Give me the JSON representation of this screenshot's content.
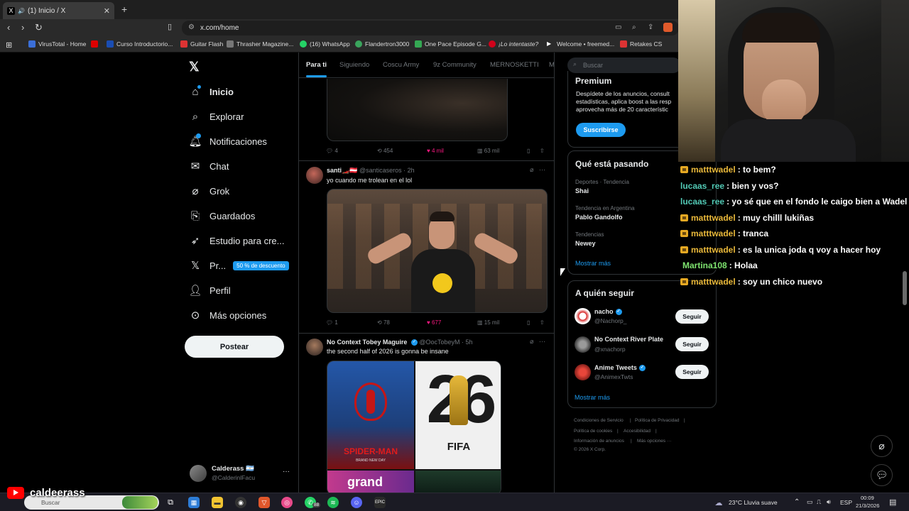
{
  "browser": {
    "tab_title": "(1) Inicio / X",
    "tab_favicon": "X",
    "url": "x.com/home",
    "bookmarks": [
      {
        "label": "VirusTotal - Home",
        "color": "#3b6fd8"
      },
      {
        "label": "Curso Introductorio...",
        "color": "#1a4db3"
      },
      {
        "label": "Guitar Flash",
        "color": "#d33"
      },
      {
        "label": "Thrasher Magazine...",
        "color": "#555"
      },
      {
        "label": "(16) WhatsApp",
        "color": "#25d366"
      },
      {
        "label": "Flandertron3000",
        "color": "#3aa55d"
      },
      {
        "label": "One Pace Episode G...",
        "color": "#34a853"
      },
      {
        "label": "¡Lo intentaste?",
        "color": "#d0021b"
      },
      {
        "label": "Welcome • freemed...",
        "color": "#fff"
      },
      {
        "label": "Retakes CS",
        "color": "#d33"
      }
    ]
  },
  "nav": {
    "items": [
      {
        "label": "Inicio",
        "icon": "home-icon"
      },
      {
        "label": "Explorar",
        "icon": "search-icon"
      },
      {
        "label": "Notificaciones",
        "icon": "bell-icon"
      },
      {
        "label": "Chat",
        "icon": "mail-icon"
      },
      {
        "label": "Grok",
        "icon": "grok-icon"
      },
      {
        "label": "Guardados",
        "icon": "bookmark-icon"
      },
      {
        "label": "Estudio para cre...",
        "icon": "rocket-icon"
      },
      {
        "label": "Pr...",
        "icon": "x-logo-icon",
        "badge": "50 % de descuento"
      },
      {
        "label": "Perfil",
        "icon": "user-icon"
      },
      {
        "label": "Más opciones",
        "icon": "more-circle-icon"
      }
    ],
    "post_button": "Postear",
    "account": {
      "name": "Calderass 🇦🇷",
      "handle": "@CalderinlFacu",
      "more": "···"
    }
  },
  "timeline": {
    "tabs": [
      "Para ti",
      "Siguiendo",
      "Coscu Army",
      "9z Community",
      "MERNOSKETTI",
      "M"
    ],
    "first_actions": {
      "replies": "4",
      "reposts": "454",
      "likes": "4 mil",
      "views": "63 mil"
    },
    "posts": [
      {
        "name": "santi🏎️🇦🇹",
        "handle": "@santicaseros · 2h",
        "text": "yo cuando me trolean en el lol",
        "actions": {
          "replies": "1",
          "reposts": "78",
          "likes": "677",
          "views": "15 mil"
        }
      },
      {
        "name": "No Context Tobey Maguire",
        "handle": "@OocTobeyM · 5h",
        "text": "the second half of 2026 is gonna be insane",
        "media_labels": {
          "spider": "SPIDER-MAN",
          "spider_sub": "BRAND NEW DAY",
          "fifa": "FIFA",
          "fifa_digits": "26",
          "gta": "grand"
        }
      }
    ]
  },
  "sidebar": {
    "search_placeholder": "Buscar",
    "premium": {
      "title": "Premium",
      "body_1": "Despídete de los anuncios, consult",
      "body_2": "estadísticas, aplica boost a las resp",
      "body_3": "aprovecha más de 20 característic",
      "button": "Suscribirse"
    },
    "trends": {
      "title": "Qué está pasando",
      "items": [
        {
          "context": "Deportes · Tendencia",
          "name": "Shai"
        },
        {
          "context": "Tendencia en Argentina",
          "name": "Pablo Gandolfo"
        },
        {
          "context": "Tendencias",
          "name": "Newey"
        }
      ],
      "more": "Mostrar más"
    },
    "who_to_follow": {
      "title": "A quién seguir",
      "items": [
        {
          "name": "nacho",
          "handle": "@Nachorp_",
          "verified": true,
          "button": "Seguir"
        },
        {
          "name": "No Context River Plate",
          "handle": "@xnachorp",
          "verified": false,
          "button": "Seguir"
        },
        {
          "name": "Anime Tweets",
          "handle": "@AnimexTwts",
          "verified": true,
          "button": "Seguir"
        }
      ],
      "more": "Mostrar más"
    },
    "footer": {
      "terms": "Condiciones de Servicio",
      "privacy": "Política de Privacidad",
      "cookies": "Política de cookies",
      "accessibility": "Accesibilidad",
      "ads": "Información de anuncios",
      "more": "Más opciones ···",
      "copyright": "© 2026 X Corp."
    }
  },
  "stream_chat": [
    {
      "user": "matttwadel",
      "msg": ": to bem?",
      "color": "gold",
      "badge": true
    },
    {
      "user": "lucaas_ree",
      "msg": ": bien y vos?",
      "color": "teal",
      "badge": false
    },
    {
      "user": "lucaas_ree",
      "msg": ": yo sé que en el fondo le caigo bien a Wadel",
      "color": "teal",
      "badge": false
    },
    {
      "user": "matttwadel",
      "msg": ": muy chilll lukiñas",
      "color": "gold",
      "badge": true
    },
    {
      "user": "matttwadel",
      "msg": ": tranca",
      "color": "gold",
      "badge": true
    },
    {
      "user": "matttwadel",
      "msg": ": es la unica joda q voy a hacer hoy",
      "color": "gold",
      "badge": true
    },
    {
      "user": "Martina108",
      "msg": ": Holaa",
      "color": "green",
      "badge": false
    },
    {
      "user": "matttwadel",
      "msg": ": soy un chico nuevo",
      "color": "gold",
      "badge": true
    }
  ],
  "stream_overlay": {
    "channel": "caldeerass"
  },
  "taskbar": {
    "search": "Buscar",
    "weather": "23°C  Lluvia suave",
    "lang": "ESP",
    "time": "00:09",
    "date": "21/3/2026",
    "whatsapp_badge": "88"
  }
}
